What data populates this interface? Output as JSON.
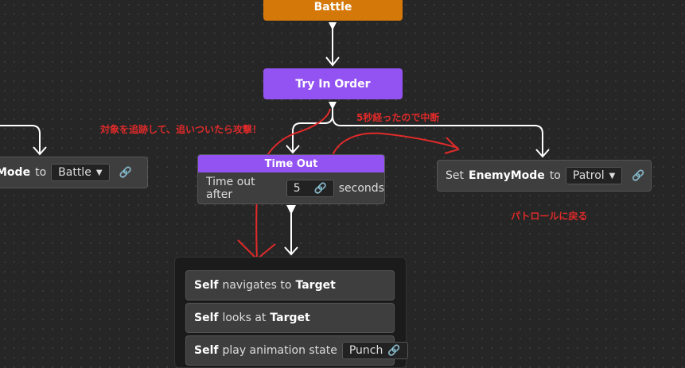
{
  "nodes": {
    "battle": "Battle",
    "try_in_order": "Try In Order",
    "left_action": {
      "label": "Mode",
      "to": "to",
      "value": "Battle"
    },
    "timeout": {
      "title": "Time Out",
      "label": "Time out after",
      "value": "5",
      "suffix": "seconds"
    },
    "set_mode": {
      "prefix": "Set",
      "subject": "EnemyMode",
      "to": "to",
      "value": "Patrol"
    },
    "sequence": [
      {
        "subject": "Self",
        "verb": "navigates to",
        "object": "Target"
      },
      {
        "subject": "Self",
        "verb": "looks at",
        "object": "Target"
      },
      {
        "subject": "Self",
        "verb": "play animation state",
        "value": "Punch"
      }
    ]
  },
  "annotations": {
    "chase": "対象を追跡して、追いついたら攻撃！",
    "interrupt": "5秒経ったので中断",
    "patrol": "パトロールに戻る"
  },
  "colors": {
    "accent_purple": "#9353f2",
    "accent_orange": "#d4780a",
    "annotation_red": "#e02a2a"
  },
  "icons": [
    "link-icon",
    "caret-down-icon"
  ]
}
